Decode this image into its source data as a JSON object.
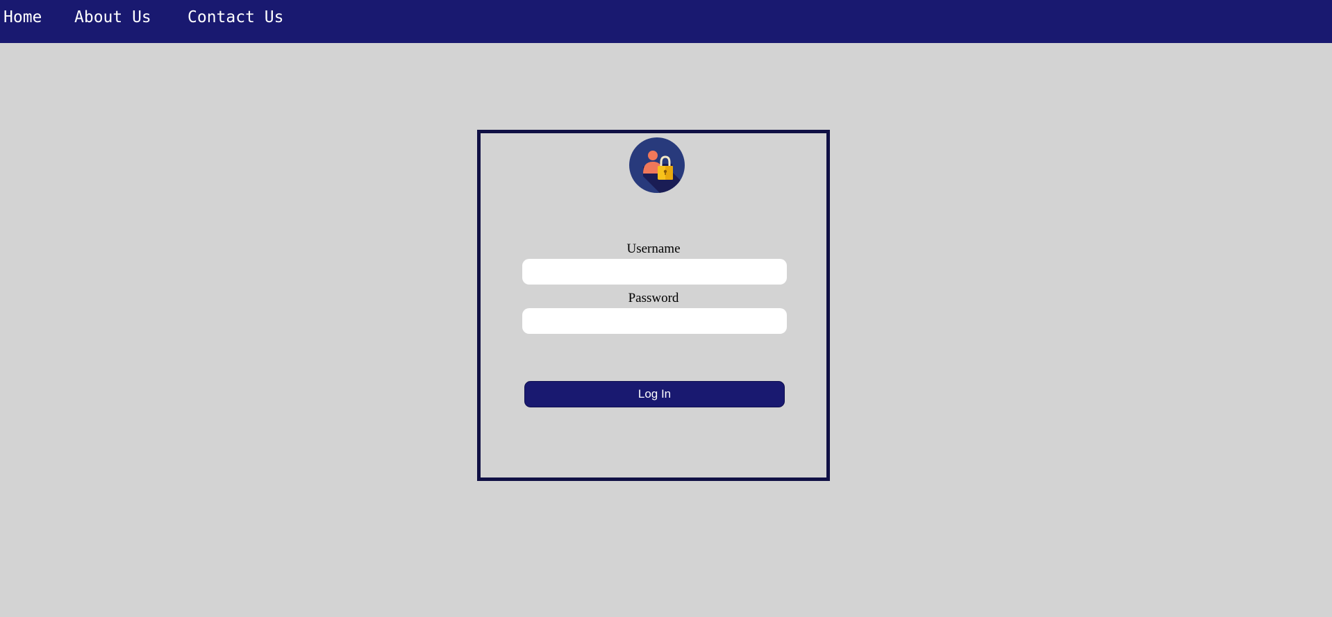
{
  "nav": {
    "items": [
      {
        "label": "Home"
      },
      {
        "label": "About Us"
      },
      {
        "label": "Contact Us"
      }
    ]
  },
  "login": {
    "avatar_icon": "user-lock-icon",
    "username_label": "Username",
    "username_value": "",
    "password_label": "Password",
    "password_value": "",
    "submit_label": "Log In"
  },
  "colors": {
    "navbar": "#191970",
    "page_background": "#d3d3d3",
    "box_border": "#101044",
    "button": "#191970",
    "avatar_circle": "#283a7c",
    "avatar_person": "#f0785a",
    "avatar_lock": "#f7c21c"
  }
}
